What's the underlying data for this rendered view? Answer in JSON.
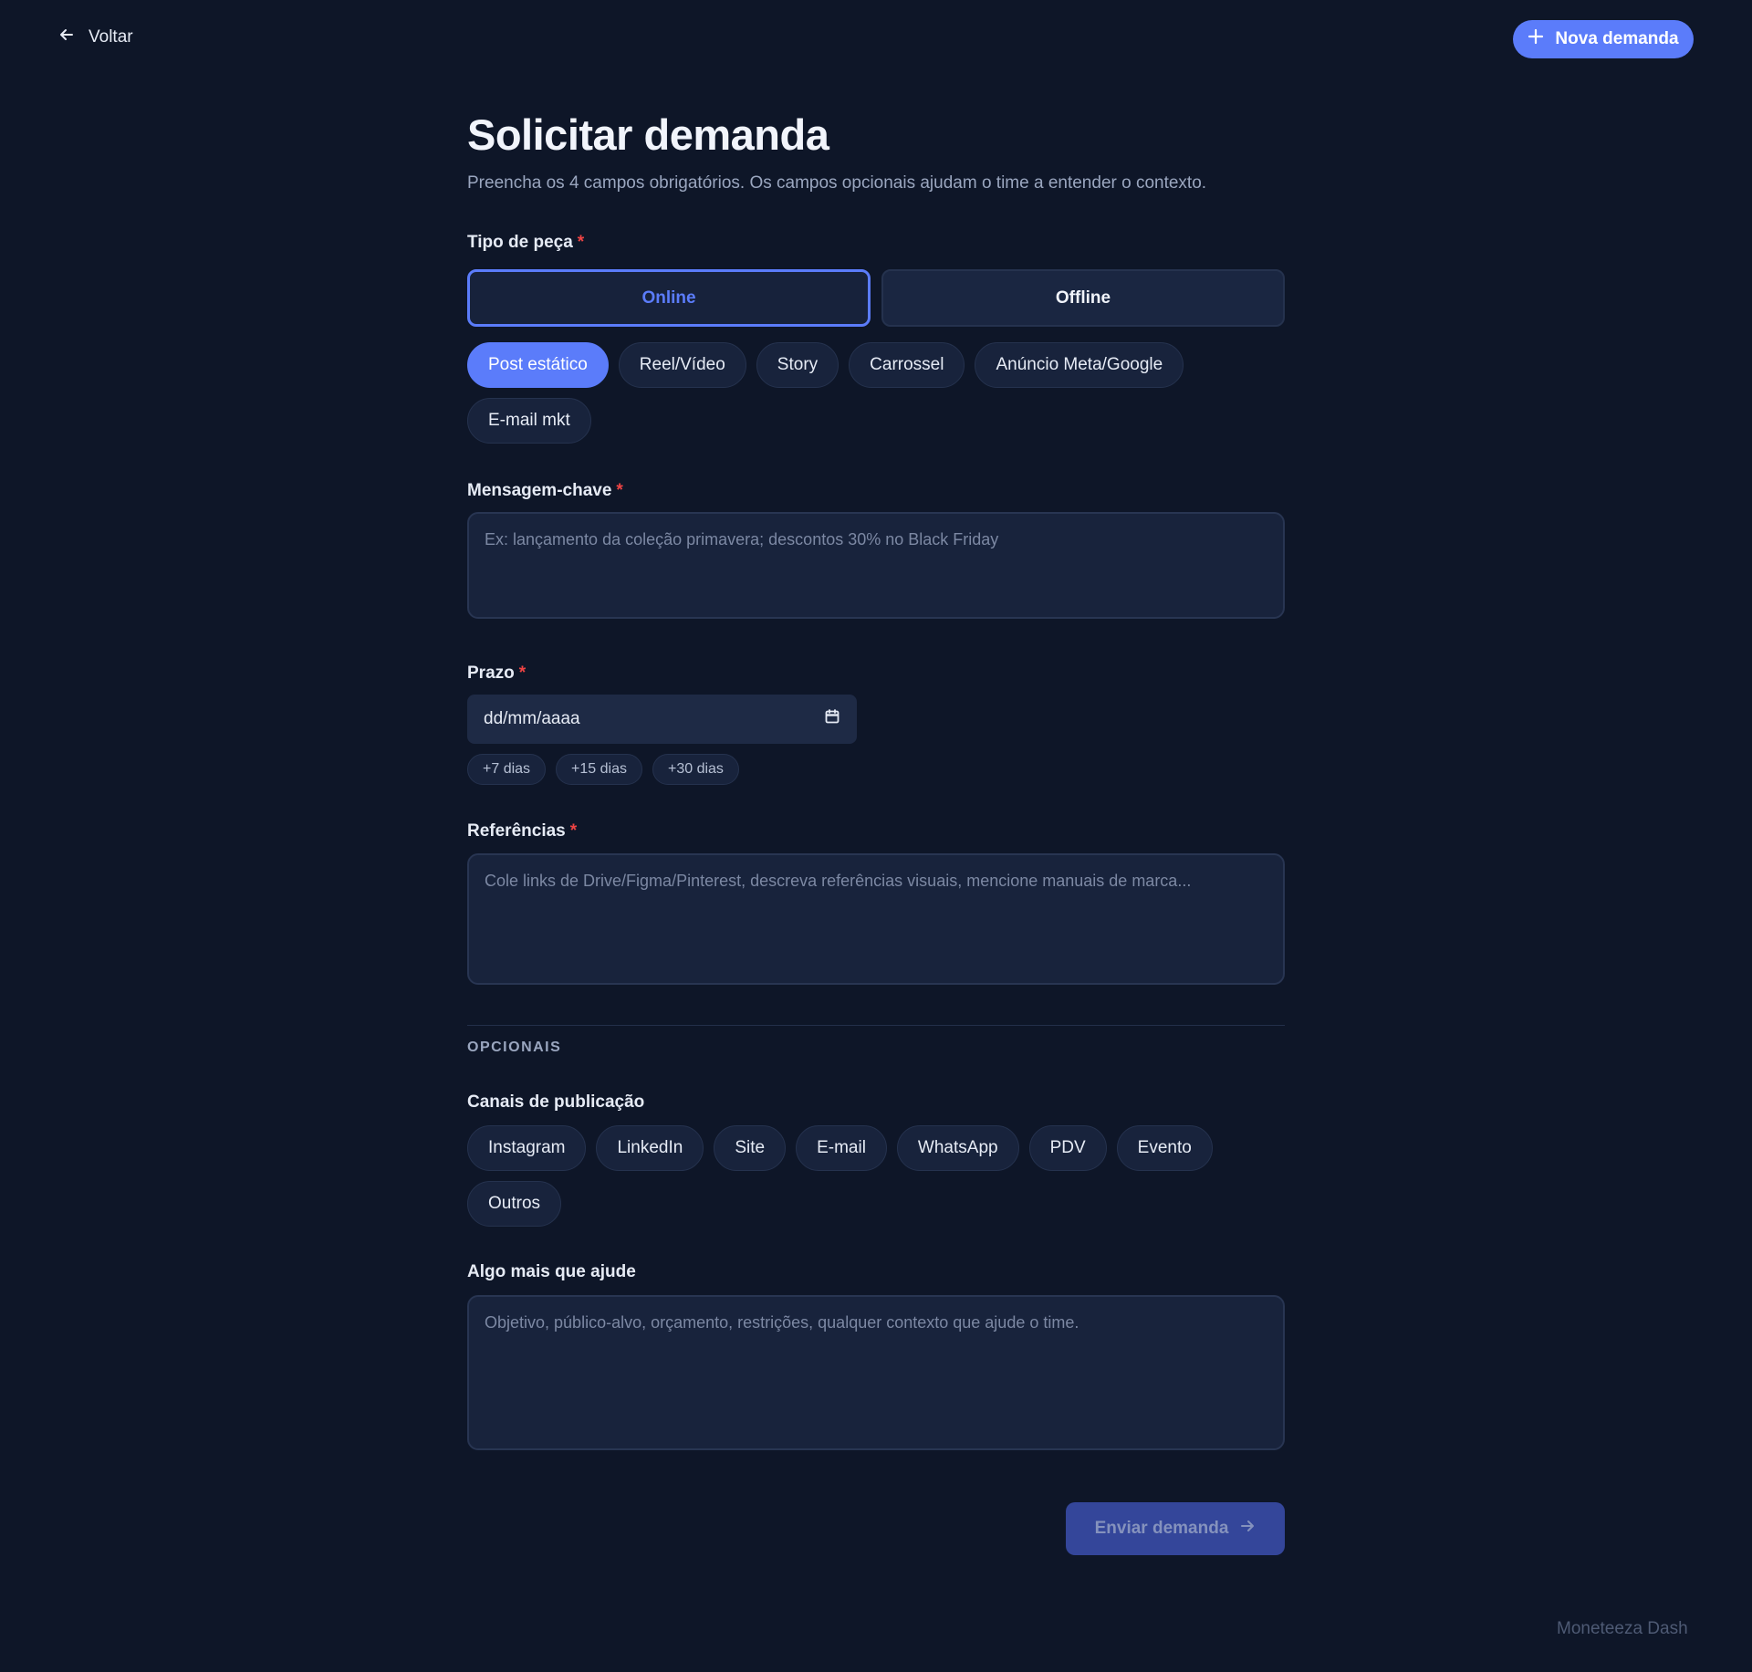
{
  "nav": {
    "back_label": "Voltar",
    "new_label": "Nova demanda"
  },
  "page": {
    "title": "Solicitar demanda",
    "subtitle": "Preencha os 4 campos obrigatórios. Os campos opcionais ajudam o time a entender o contexto."
  },
  "tipo": {
    "label": "Tipo de peça",
    "required_mark": "*",
    "options": [
      {
        "label": "Online",
        "selected": true
      },
      {
        "label": "Offline",
        "selected": false
      }
    ],
    "formats": [
      {
        "label": "Post estático",
        "selected": true
      },
      {
        "label": "Reel/Vídeo",
        "selected": false
      },
      {
        "label": "Story",
        "selected": false
      },
      {
        "label": "Carrossel",
        "selected": false
      },
      {
        "label": "Anúncio Meta/Google",
        "selected": false
      },
      {
        "label": "E-mail mkt",
        "selected": false
      }
    ]
  },
  "mensagem": {
    "label": "Mensagem-chave",
    "required_mark": "*",
    "placeholder": "Ex: lançamento da coleção primavera; descontos 30% no Black Friday"
  },
  "prazo": {
    "label": "Prazo",
    "required_mark": "*",
    "placeholder": "dd/mm/aaaa",
    "shortcuts": [
      "+7 dias",
      "+15 dias",
      "+30 dias"
    ]
  },
  "referencias": {
    "label": "Referências",
    "required_mark": "*",
    "placeholder": "Cole links de Drive/Figma/Pinterest, descreva referências visuais, mencione manuais de marca..."
  },
  "opcionais": {
    "section_label": "OPCIONAIS",
    "canais_label": "Canais de publicação",
    "canais": [
      "Instagram",
      "LinkedIn",
      "Site",
      "E-mail",
      "WhatsApp",
      "PDV",
      "Evento",
      "Outros"
    ],
    "extra_label": "Algo mais que ajude",
    "extra_placeholder": "Objetivo, público-alvo, orçamento, restrições, qualquer contexto que ajude o time."
  },
  "submit_label": "Enviar demanda",
  "footer_brand": "Moneteeza Dash",
  "colors": {
    "background": "#0e1628",
    "accent": "#5b7cfa",
    "required": "#ef4444",
    "submit_disabled": "#34469a"
  }
}
